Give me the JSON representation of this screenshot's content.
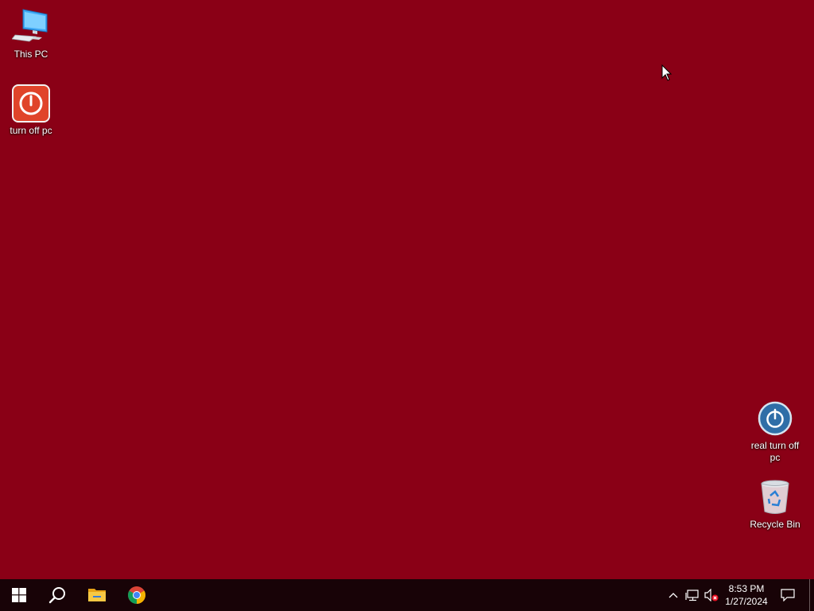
{
  "desktop": {
    "background": "#8a0016",
    "icons": [
      {
        "label": "This PC",
        "icon": "this-pc-icon"
      },
      {
        "label": "turn off pc",
        "icon": "power-red-icon"
      },
      {
        "label": "real turn off pc",
        "icon": "power-blue-icon"
      },
      {
        "label": "Recycle Bin",
        "icon": "recycle-bin-icon"
      }
    ]
  },
  "taskbar": {
    "background": "#180307",
    "pinned": [
      {
        "name": "Start",
        "icon": "windows-logo-icon"
      },
      {
        "name": "Search",
        "icon": "search-icon"
      },
      {
        "name": "File Explorer",
        "icon": "folder-icon"
      },
      {
        "name": "Google Chrome",
        "icon": "chrome-icon"
      }
    ],
    "clock": {
      "time": "8:53 PM",
      "date": "1/27/2024"
    }
  }
}
